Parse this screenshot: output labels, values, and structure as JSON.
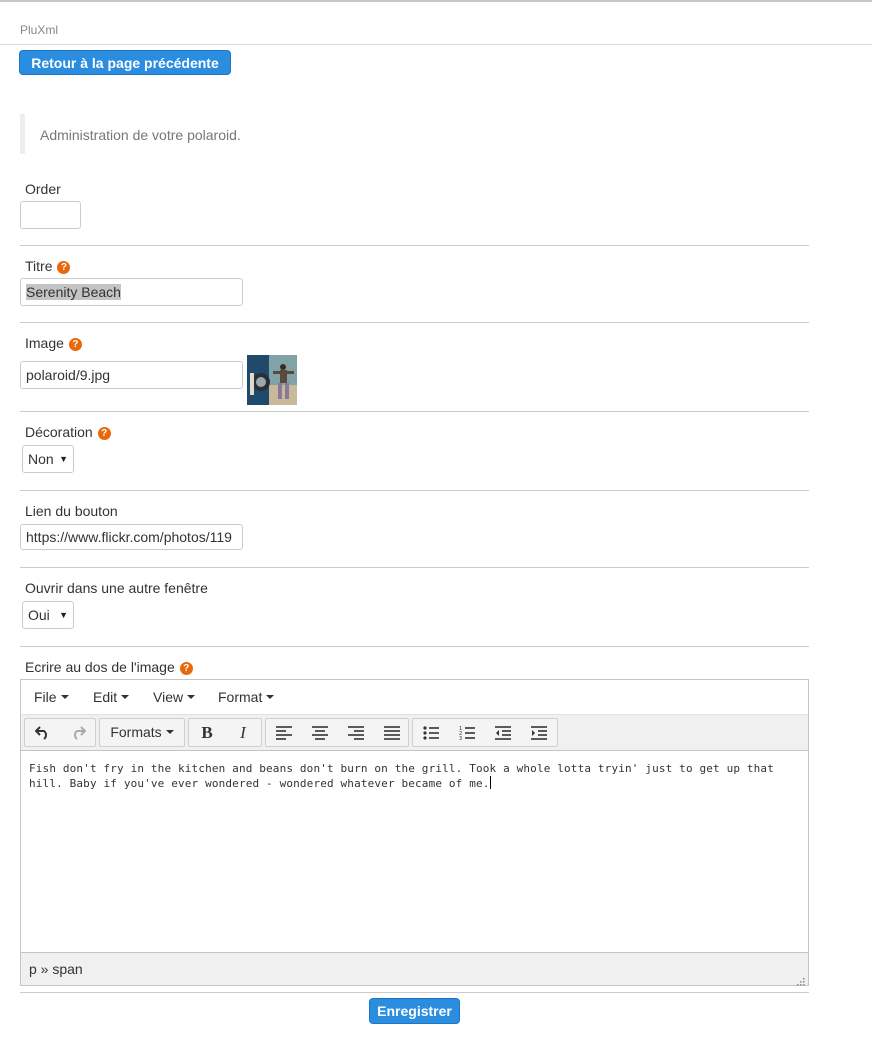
{
  "header": {
    "app_name": "PluXml",
    "back_button": "Retour à la page précédente"
  },
  "intro": "Administration de votre polaroid.",
  "form": {
    "order": {
      "label": "Order",
      "value": ""
    },
    "titre": {
      "label": "Titre",
      "value": "Serenity Beach"
    },
    "image": {
      "label": "Image",
      "value": "polaroid/9.jpg"
    },
    "decoration": {
      "label": "Décoration",
      "selected": "Non"
    },
    "lien": {
      "label": "Lien du bouton",
      "value": "https://www.flickr.com/photos/119"
    },
    "ouvrir": {
      "label": "Ouvrir dans une autre fenêtre",
      "selected": "Oui"
    },
    "ecrire": {
      "label": "Ecrire au dos de l'image"
    }
  },
  "help_glyph": "?",
  "editor": {
    "menu": [
      "File",
      "Edit",
      "View",
      "Format"
    ],
    "formats_label": "Formats",
    "content": "Fish don't fry in the kitchen and beans don't burn on the grill. Took a whole lotta tryin' just to get up that hill. Baby if you've ever wondered - wondered whatever became of me.",
    "status_path": "p » span",
    "toolbar_icons": [
      "undo-icon",
      "redo-icon",
      "formats-dropdown",
      "bold-icon",
      "italic-icon",
      "align-left-icon",
      "align-center-icon",
      "align-right-icon",
      "align-justify-icon",
      "bullet-list-icon",
      "numbered-list-icon",
      "outdent-icon",
      "indent-icon"
    ]
  },
  "save_button": "Enregistrer",
  "colors": {
    "primary": "#2b8de0",
    "help": "#e8680e"
  }
}
